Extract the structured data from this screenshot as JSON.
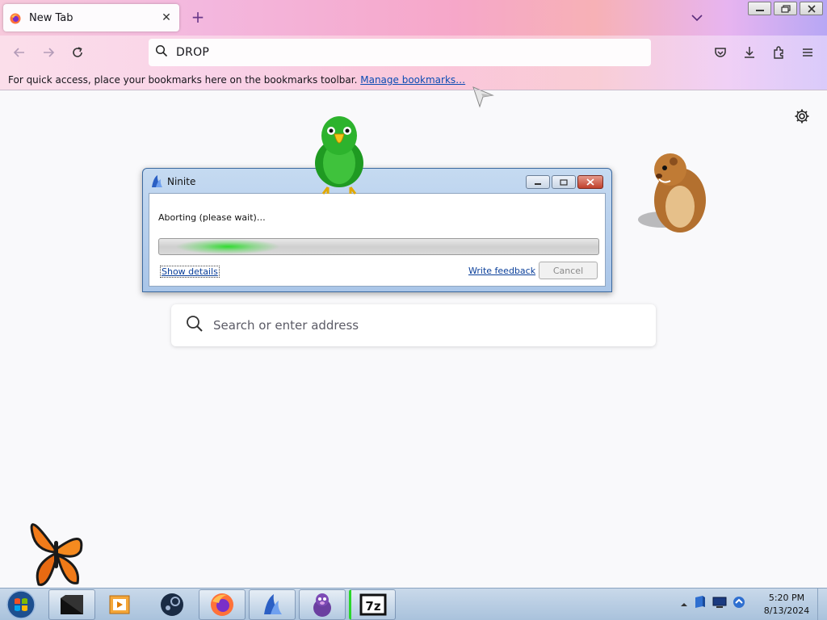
{
  "browser": {
    "tab": {
      "title": "New Tab",
      "close_glyph": "✕"
    },
    "new_tab_glyph": "+",
    "url": "DROP",
    "bookmarks_bar": {
      "message": "For quick access, place your bookmarks here on the bookmarks toolbar.",
      "link": "Manage bookmarks…"
    },
    "search_placeholder": "Search or enter address",
    "icons": [
      "back-icon",
      "forward-icon",
      "reload-icon",
      "search-icon",
      "pocket-icon",
      "download-icon",
      "extensions-icon",
      "menu-icon",
      "gear-icon"
    ]
  },
  "dialog": {
    "title": "Ninite",
    "status": "Aborting (please wait)…",
    "progress_percent": 25,
    "show_details": "Show details",
    "write_feedback": "Write feedback",
    "cancel": "Cancel"
  },
  "taskbar": {
    "items": [
      "terminal",
      "media-player",
      "steam",
      "firefox",
      "ninite",
      "bonzi-buddy",
      "7zip"
    ],
    "clock": {
      "time": "5:20 PM",
      "date": "8/13/2024"
    },
    "sevenzip_label": "7z"
  },
  "colors": {
    "accent_link": "#0a4bb3",
    "progress_green": "#28dc28",
    "dialog_frame": "#a9c5e8",
    "taskbar": "#b9cfe4"
  }
}
